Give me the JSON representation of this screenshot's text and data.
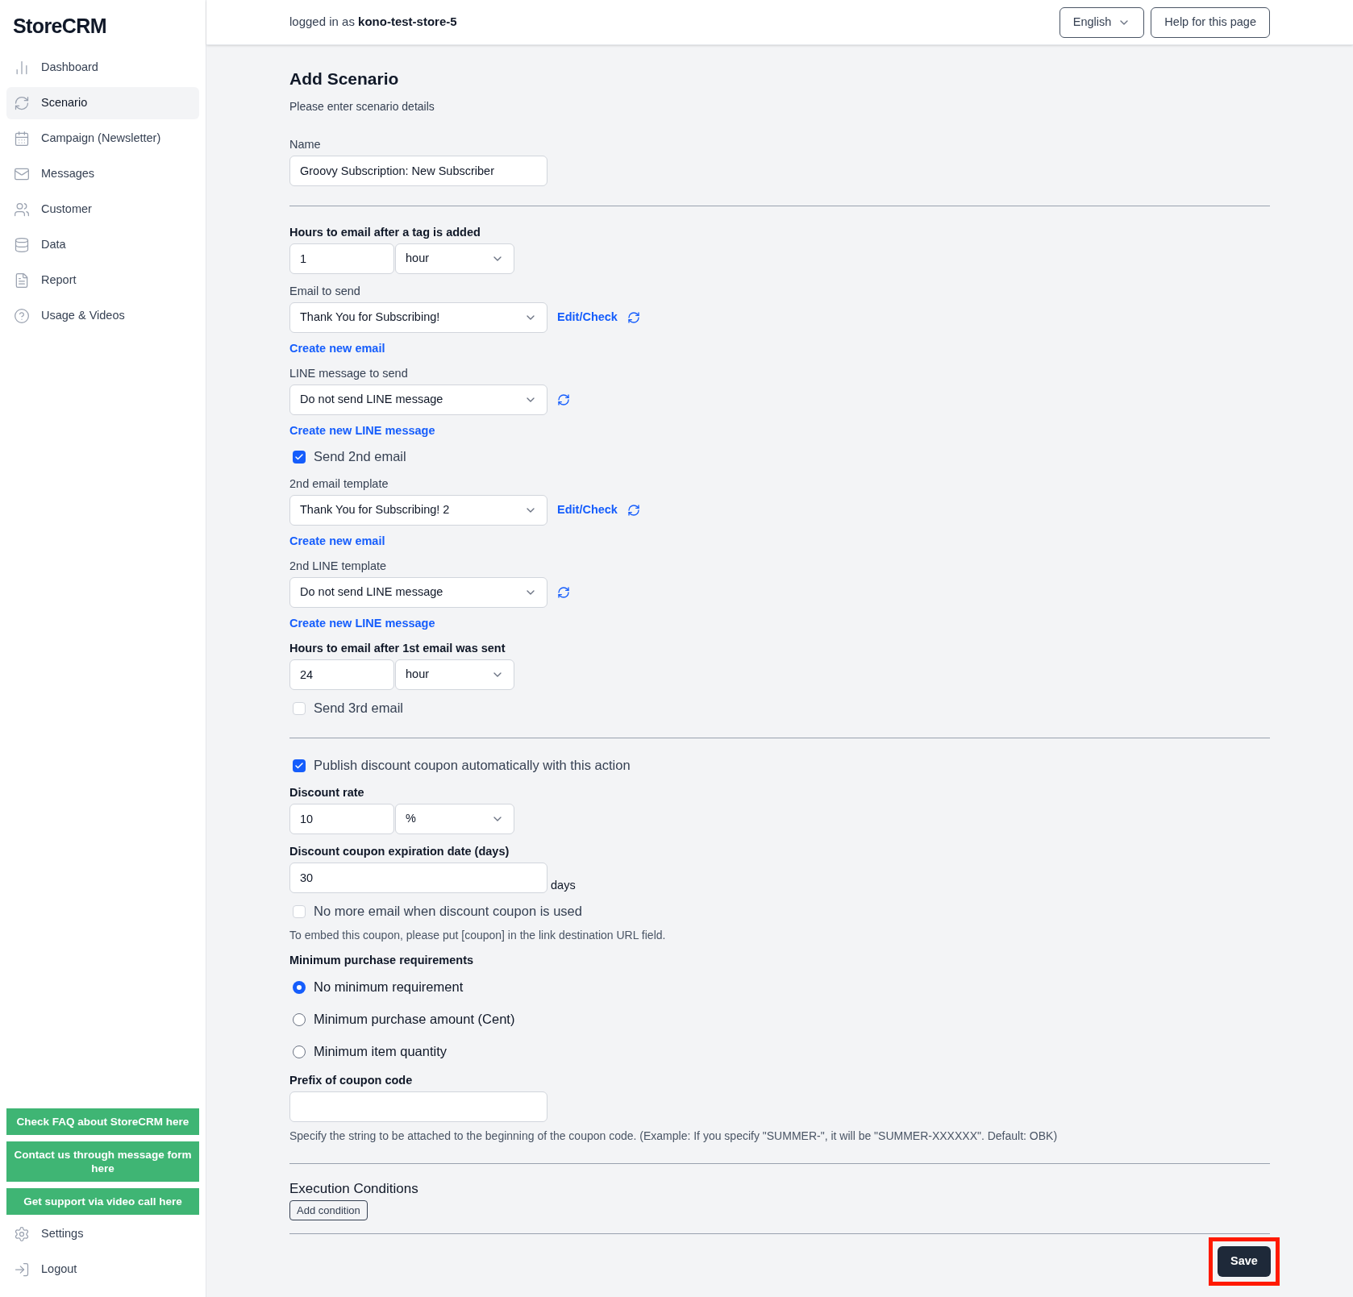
{
  "sidebar": {
    "logo": "StoreCRM",
    "items": [
      {
        "label": "Dashboard",
        "selected": false
      },
      {
        "label": "Scenario",
        "selected": true
      },
      {
        "label": "Campaign (Newsletter)",
        "selected": false
      },
      {
        "label": "Messages",
        "selected": false
      },
      {
        "label": "Customer",
        "selected": false
      },
      {
        "label": "Data",
        "selected": false
      },
      {
        "label": "Report",
        "selected": false
      },
      {
        "label": "Usage & Videos",
        "selected": false
      }
    ],
    "help_buttons": [
      "Check FAQ about StoreCRM here",
      "Contact us through message form here",
      "Get support via video call here"
    ],
    "bottom_items": [
      "Settings",
      "Logout"
    ]
  },
  "header": {
    "prefix": "logged in as",
    "user": "kono-test-store-5",
    "language": "English",
    "help": "Help for this page"
  },
  "form": {
    "title": "Add Scenario",
    "subtitle": "Please enter scenario details",
    "sections": [
      [
        {
          "kind": "text",
          "label": "Name",
          "bold": false,
          "value": "Groovy Subscription: New Subscriber"
        }
      ],
      [
        {
          "kind": "number_unit",
          "label": "Hours to email after a tag is added",
          "bold": true,
          "value": "1",
          "unit": "hour"
        },
        {
          "kind": "select",
          "label": "Email to send",
          "bold": false,
          "value": "Thank You for Subscribing!",
          "edit_link": "Edit/Check"
        },
        {
          "kind": "link",
          "text": "Create new email"
        },
        {
          "kind": "select",
          "label": "LINE message to send",
          "bold": false,
          "value": "Do not send LINE message"
        },
        {
          "kind": "link",
          "text": "Create new LINE message"
        },
        {
          "kind": "checkbox",
          "label": "Send 2nd email",
          "checked": true
        },
        {
          "kind": "select",
          "label": "2nd email template",
          "bold": false,
          "value": "Thank You for Subscribing! 2",
          "edit_link": "Edit/Check"
        },
        {
          "kind": "link",
          "text": "Create new email"
        },
        {
          "kind": "select",
          "label": "2nd LINE template",
          "bold": false,
          "value": "Do not send LINE message"
        },
        {
          "kind": "link",
          "text": "Create new LINE message"
        },
        {
          "kind": "number_unit",
          "label": "Hours to email after 1st email was sent",
          "bold": true,
          "value": "24",
          "unit": "hour"
        },
        {
          "kind": "checkbox",
          "label": "Send 3rd email",
          "checked": false
        }
      ],
      [
        {
          "kind": "checkbox",
          "label": "Publish discount coupon automatically with this action",
          "checked": true
        },
        {
          "kind": "number_unit",
          "label": "Discount rate",
          "bold": true,
          "value": "10",
          "unit": "%"
        },
        {
          "kind": "text",
          "label": "Discount coupon expiration date (days)",
          "bold": true,
          "value": "30",
          "suffix": "days"
        },
        {
          "kind": "checkbox",
          "label": "No more email when discount coupon is used",
          "checked": false
        },
        {
          "kind": "note",
          "text": "To embed this coupon, please put [coupon] in the link destination URL field."
        },
        {
          "kind": "radio_group",
          "label": "Minimum purchase requirements",
          "options": [
            {
              "label": "No minimum requirement",
              "selected": true
            },
            {
              "label": "Minimum purchase amount (Cent)",
              "selected": false
            },
            {
              "label": "Minimum item quantity",
              "selected": false
            }
          ]
        },
        {
          "kind": "text",
          "label": "Prefix of coupon code",
          "bold": true
        },
        {
          "kind": "note",
          "text": "Specify the string to be attached to the beginning of the coupon code. (Example: If you specify \"SUMMER-\", it will be \"SUMMER-XXXXXX\". Default: OBK)"
        }
      ]
    ],
    "execution": {
      "title": "Execution Conditions",
      "button": "Add condition"
    },
    "save": {
      "label": "Save",
      "highlighted": true
    }
  }
}
